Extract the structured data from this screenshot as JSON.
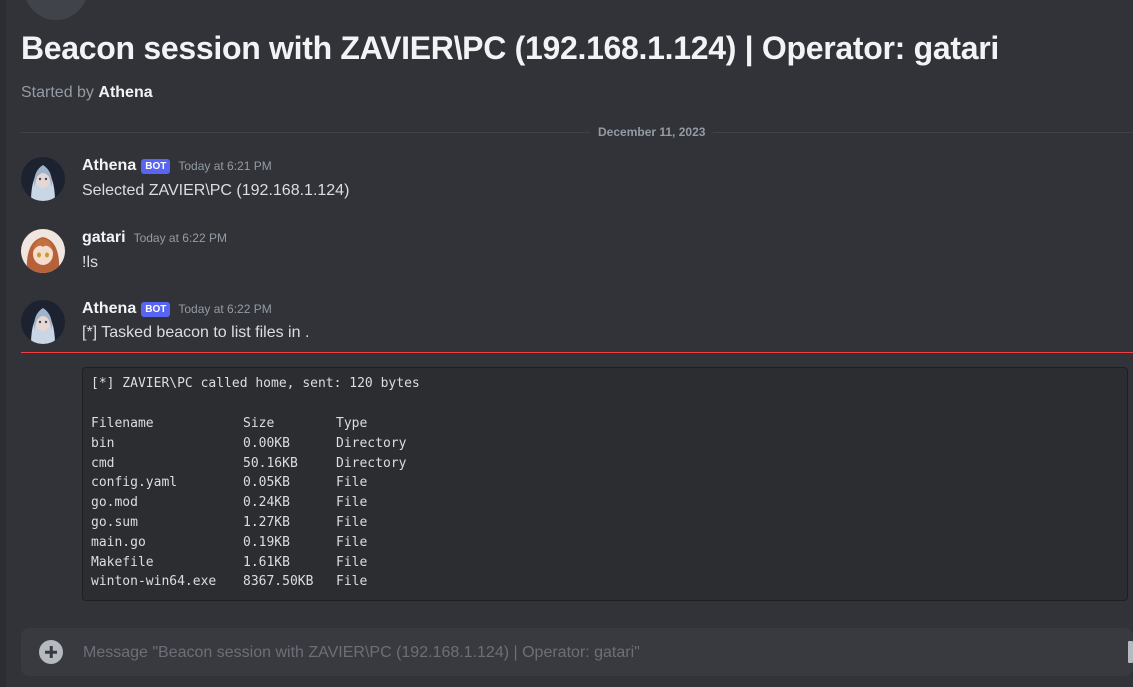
{
  "thread": {
    "title": "Beacon session with ZAVIER\\PC (192.168.1.124) | Operator: gatari",
    "started_by_prefix": "Started by",
    "started_by_name": "Athena"
  },
  "date_divider": "December 11, 2023",
  "messages": [
    {
      "author": "Athena",
      "bot_tag": "BOT",
      "timestamp": "Today at 6:21 PM",
      "text": "Selected ZAVIER\\PC (192.168.1.124)"
    },
    {
      "author": "gatari",
      "timestamp": "Today at 6:22 PM",
      "text": "!ls"
    },
    {
      "author": "Athena",
      "bot_tag": "BOT",
      "timestamp": "Today at 6:22 PM",
      "text": "[*] Tasked beacon to list files in ."
    }
  ],
  "codeblock": {
    "header": "[*] ZAVIER\\PC called home, sent: 120 bytes",
    "columns": [
      "Filename",
      "Size",
      "Type"
    ],
    "rows": [
      [
        "bin",
        "0.00KB",
        "Directory"
      ],
      [
        "cmd",
        "50.16KB",
        "Directory"
      ],
      [
        "config.yaml",
        "0.05KB",
        "File"
      ],
      [
        "go.mod",
        "0.24KB",
        "File"
      ],
      [
        "go.sum",
        "1.27KB",
        "File"
      ],
      [
        "main.go",
        "0.19KB",
        "File"
      ],
      [
        "Makefile",
        "1.61KB",
        "File"
      ],
      [
        "winton-win64.exe",
        "8367.50KB",
        "File"
      ]
    ]
  },
  "composer": {
    "placeholder": "Message \"Beacon session with ZAVIER\\PC (192.168.1.124) | Operator: gatari\""
  }
}
